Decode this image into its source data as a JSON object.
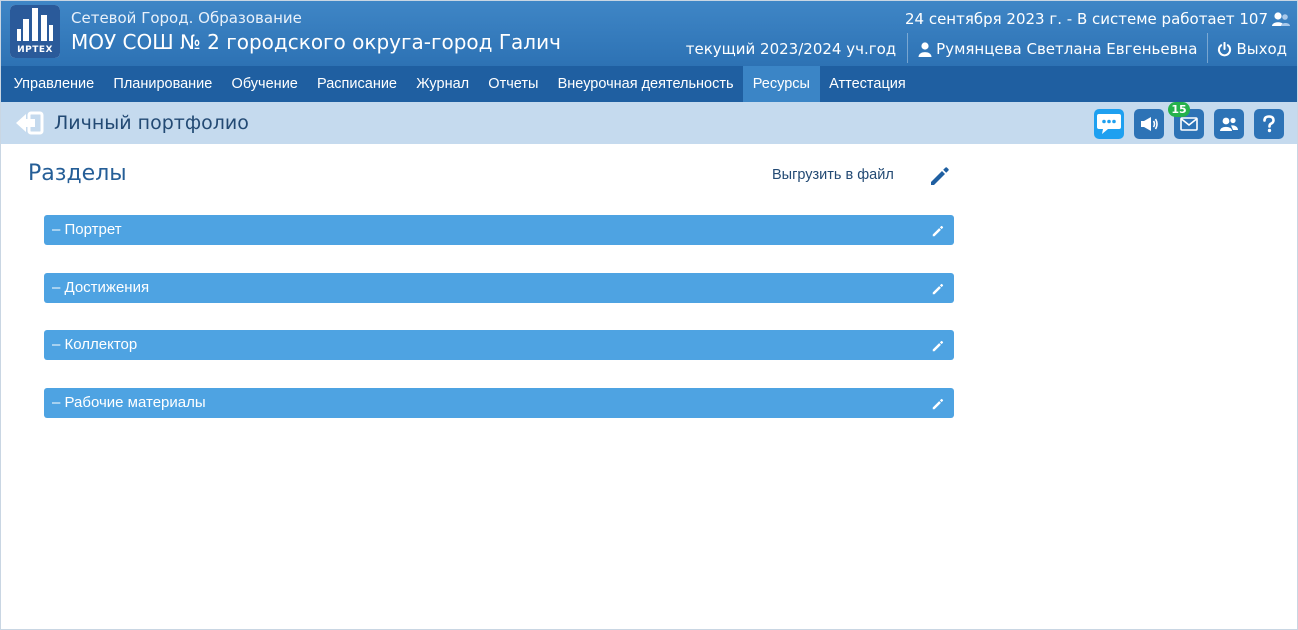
{
  "header": {
    "logo_text": "ИРТЕХ",
    "system_name": "Сетевой Город. Образование",
    "school_name": "МОУ СОШ № 2 городского округа-город Галич",
    "date_status": "24 сентября 2023 г. - В системе работает 107",
    "academic_year": "текущий 2023/2024 уч.год",
    "user_name": "Румянцева Светлана Евгеньевна",
    "logout_label": "Выход"
  },
  "menu": {
    "items": [
      {
        "label": "Управление"
      },
      {
        "label": "Планирование"
      },
      {
        "label": "Обучение"
      },
      {
        "label": "Расписание"
      },
      {
        "label": "Журнал"
      },
      {
        "label": "Отчеты"
      },
      {
        "label": "Внеурочная деятельность"
      },
      {
        "label": "Ресурсы",
        "active": true
      },
      {
        "label": "Аттестация"
      }
    ]
  },
  "breadcrumb": {
    "title": "Личный портфолио",
    "mail_badge": "15",
    "icons": [
      "chat-icon",
      "megaphone-icon",
      "mail-icon",
      "users-icon",
      "help-icon"
    ]
  },
  "main": {
    "title": "Разделы",
    "export_label": "Выгрузить в файл",
    "sections": [
      {
        "label": "– Портрет"
      },
      {
        "label": "– Достижения"
      },
      {
        "label": "– Коллектор"
      },
      {
        "label": "– Рабочие материалы"
      }
    ]
  },
  "colors": {
    "header": "#2d72b4",
    "menu": "#1f5fa1",
    "menu_active": "#3b85c6",
    "crumb_bar": "#c5daee",
    "section_bar": "#4ea3e2",
    "badge": "#25b24c"
  }
}
